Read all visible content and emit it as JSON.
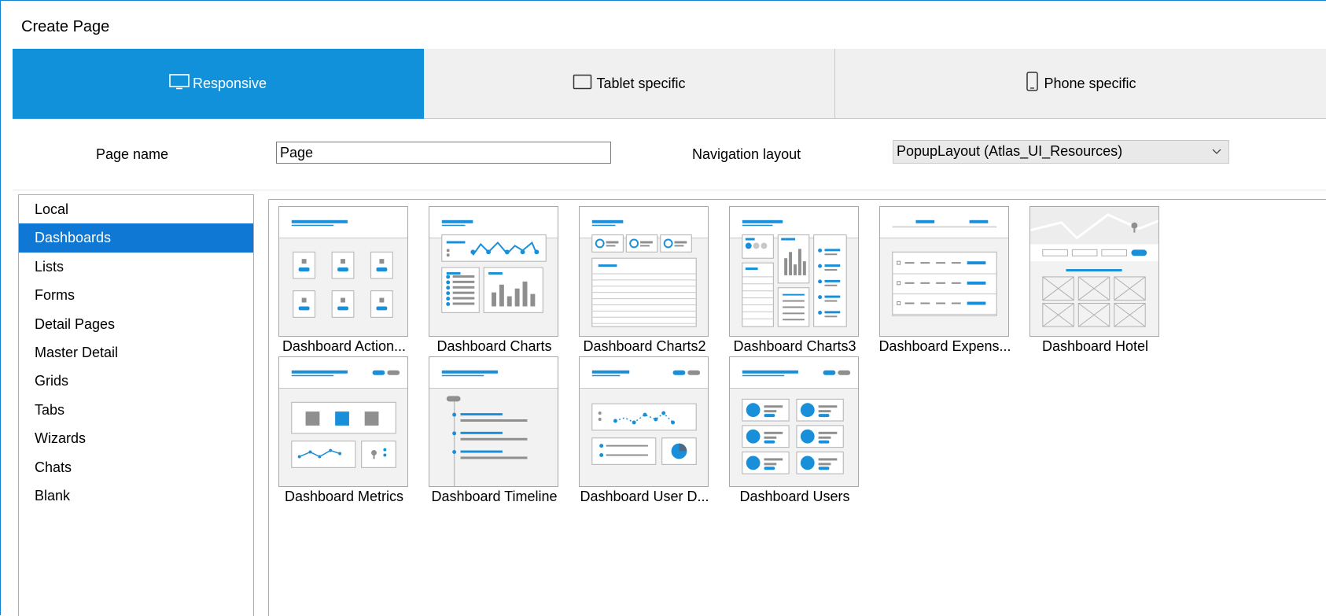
{
  "window": {
    "title": "Create Page"
  },
  "tabs": [
    {
      "label": "Responsive",
      "icon": "monitor-icon",
      "active": true
    },
    {
      "label": "Tablet specific",
      "icon": "tablet-icon",
      "active": false
    },
    {
      "label": "Phone specific",
      "icon": "phone-icon",
      "active": false
    }
  ],
  "form": {
    "page_name_label": "Page name",
    "page_name_value": "Page",
    "nav_layout_label": "Navigation layout",
    "nav_layout_value": "PopupLayout (Atlas_UI_Resources)"
  },
  "categories": {
    "selected": "Dashboards",
    "items": [
      "Local",
      "Dashboards",
      "Lists",
      "Forms",
      "Detail Pages",
      "Master Detail",
      "Grids",
      "Tabs",
      "Wizards",
      "Chats",
      "Blank"
    ]
  },
  "templates": [
    {
      "label": "Dashboard Action...",
      "thumb": "actions"
    },
    {
      "label": "Dashboard Charts",
      "thumb": "charts"
    },
    {
      "label": "Dashboard Charts2",
      "thumb": "charts2"
    },
    {
      "label": "Dashboard Charts3",
      "thumb": "charts3"
    },
    {
      "label": "Dashboard Expens...",
      "thumb": "expenses"
    },
    {
      "label": "Dashboard Hotel",
      "thumb": "hotel"
    },
    {
      "label": "Dashboard Metrics",
      "thumb": "metrics"
    },
    {
      "label": "Dashboard Timeline",
      "thumb": "timeline"
    },
    {
      "label": "Dashboard User D...",
      "thumb": "userdetail"
    },
    {
      "label": "Dashboard Users",
      "thumb": "users"
    }
  ],
  "colors": {
    "accent": "#1291db",
    "selection": "#0f78d4",
    "thumb_blue": "#1a8fd9",
    "thumb_gray": "#8f8f8f"
  }
}
